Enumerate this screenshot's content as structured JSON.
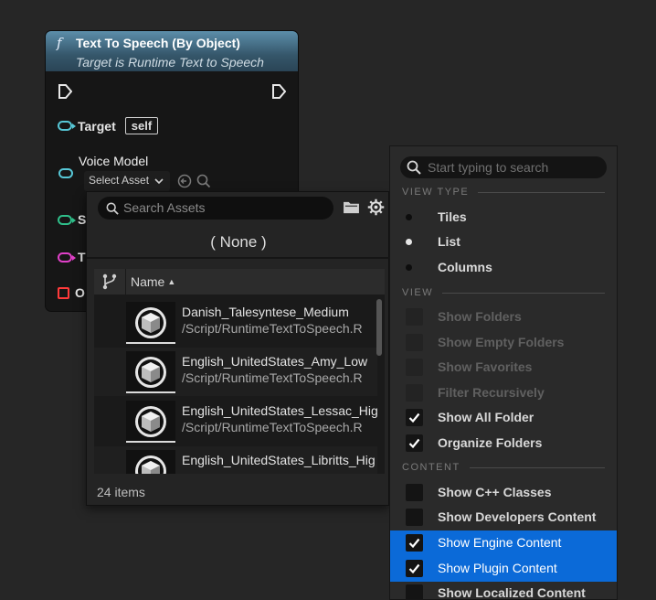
{
  "node": {
    "func_icon": "f",
    "title": "Text To Speech (By Object)",
    "subtitle": "Target is Runtime Text to Speech",
    "pins": {
      "target_label": "Target",
      "target_value": "self",
      "voice_model_label": "Voice Model",
      "select_asset_label": "Select Asset",
      "hidden_pin_1_label": "S",
      "hidden_pin_2_label": "T",
      "hidden_pin_3_label": "O"
    },
    "colors": {
      "header": "#35566a",
      "object_pin": "#57c7d6",
      "byte_pin": "#2fbf8a",
      "string_pin": "#e040c8",
      "struct_pin": "#ff3a3a"
    }
  },
  "asset_picker": {
    "search_placeholder": "Search Assets",
    "none_label": "( None )",
    "column_name": "Name",
    "items": [
      {
        "name": "Danish_Talesyntese_Medium",
        "path": "/Script/RuntimeTextToSpeech.R"
      },
      {
        "name": "English_UnitedStates_Amy_Low",
        "path": "/Script/RuntimeTextToSpeech.R"
      },
      {
        "name": "English_UnitedStates_Lessac_Hig",
        "path": "/Script/RuntimeTextToSpeech.R"
      },
      {
        "name": "English_UnitedStates_Libritts_Hig",
        "path": ""
      }
    ],
    "item_count": "24 items"
  },
  "view_menu": {
    "search_placeholder": "Start typing to search",
    "sections": {
      "view_type": "VIEW TYPE",
      "view": "VIEW",
      "content": "CONTENT"
    },
    "view_type_options": [
      {
        "label": "Tiles",
        "selected": false
      },
      {
        "label": "List",
        "selected": true
      },
      {
        "label": "Columns",
        "selected": false
      }
    ],
    "view_options": [
      {
        "label": "Show Folders",
        "checked": false,
        "enabled": false
      },
      {
        "label": "Show Empty Folders",
        "checked": false,
        "enabled": false
      },
      {
        "label": "Show Favorites",
        "checked": false,
        "enabled": false
      },
      {
        "label": "Filter Recursively",
        "checked": false,
        "enabled": false
      },
      {
        "label": "Show All Folder",
        "checked": true,
        "enabled": true
      },
      {
        "label": "Organize Folders",
        "checked": true,
        "enabled": true
      }
    ],
    "content_options": [
      {
        "label": "Show C++ Classes",
        "checked": false,
        "highlighted": false
      },
      {
        "label": "Show Developers Content",
        "checked": false,
        "highlighted": false
      },
      {
        "label": "Show Engine Content",
        "checked": true,
        "highlighted": true
      },
      {
        "label": "Show Plugin Content",
        "checked": true,
        "highlighted": true
      },
      {
        "label": "Show Localized Content",
        "checked": false,
        "highlighted": false
      }
    ],
    "highlight_color": "#0b6ad8"
  }
}
